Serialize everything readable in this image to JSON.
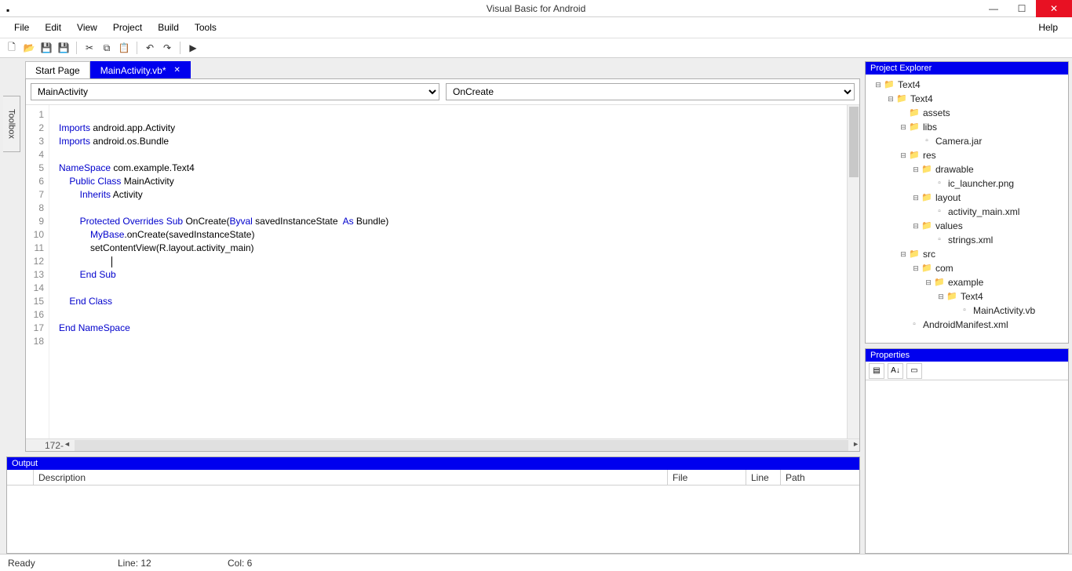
{
  "window": {
    "title": "Visual Basic for Android"
  },
  "menu": {
    "file": "File",
    "edit": "Edit",
    "view": "View",
    "project": "Project",
    "build": "Build",
    "tools": "Tools",
    "help": "Help"
  },
  "tabs": {
    "start": "Start Page",
    "active": "MainActivity.vb*"
  },
  "combos": {
    "left": "MainActivity",
    "right": "OnCreate"
  },
  "code": {
    "lines": [
      "1",
      "2",
      "3",
      "4",
      "5",
      "6",
      "7",
      "8",
      "9",
      "10",
      "11",
      "12",
      "13",
      "14",
      "15",
      "16",
      "17",
      "18"
    ]
  },
  "code_tokens": [
    [],
    [
      {
        "t": "Imports",
        "k": 1
      },
      {
        "t": " android.app.Activity"
      }
    ],
    [
      {
        "t": "Imports",
        "k": 1
      },
      {
        "t": " android.os.Bundle"
      }
    ],
    [],
    [
      {
        "t": "NameSpace",
        "k": 1
      },
      {
        "t": " com.example.Text4"
      }
    ],
    [
      {
        "t": "    "
      },
      {
        "t": "Public",
        "k": 1
      },
      {
        "t": " "
      },
      {
        "t": "Class",
        "k": 1
      },
      {
        "t": " MainActivity"
      }
    ],
    [
      {
        "t": "        "
      },
      {
        "t": "Inherits",
        "k": 1
      },
      {
        "t": " Activity"
      }
    ],
    [],
    [
      {
        "t": "        "
      },
      {
        "t": "Protected",
        "k": 1
      },
      {
        "t": " "
      },
      {
        "t": "Overrides",
        "k": 1
      },
      {
        "t": " "
      },
      {
        "t": "Sub",
        "k": 1
      },
      {
        "t": " OnCreate("
      },
      {
        "t": "Byval",
        "k": 1
      },
      {
        "t": " savedInstanceState  "
      },
      {
        "t": "As",
        "k": 1
      },
      {
        "t": " Bundle)"
      }
    ],
    [
      {
        "t": "            "
      },
      {
        "t": "MyBase",
        "k": 1
      },
      {
        "t": ".onCreate(savedInstanceState)"
      }
    ],
    [
      {
        "t": "            setContentView(R.layout.activity_main)"
      }
    ],
    [
      {
        "t": "                    "
      },
      {
        "cur": 1
      }
    ],
    [
      {
        "t": "        "
      },
      {
        "t": "End",
        "k": 1
      },
      {
        "t": " "
      },
      {
        "t": "Sub",
        "k": 1
      }
    ],
    [],
    [
      {
        "t": "    "
      },
      {
        "t": "End",
        "k": 1
      },
      {
        "t": " "
      },
      {
        "t": "Class",
        "k": 1
      }
    ],
    [],
    [
      {
        "t": "End",
        "k": 1
      },
      {
        "t": " "
      },
      {
        "t": "NameSpace",
        "k": 1
      }
    ],
    []
  ],
  "zoom": "172-",
  "output": {
    "title": "Output",
    "cols": {
      "desc": "Description",
      "file": "File",
      "line": "Line",
      "path": "Path"
    }
  },
  "explorer": {
    "title": "Project Explorer"
  },
  "tree": [
    {
      "d": 0,
      "e": "-",
      "ic": "f",
      "l": "Text4"
    },
    {
      "d": 1,
      "e": "-",
      "ic": "f",
      "l": "Text4"
    },
    {
      "d": 2,
      "e": "",
      "ic": "f",
      "l": "assets"
    },
    {
      "d": 2,
      "e": "-",
      "ic": "f",
      "l": "libs"
    },
    {
      "d": 3,
      "e": "",
      "ic": "i",
      "l": "Camera.jar"
    },
    {
      "d": 2,
      "e": "-",
      "ic": "f",
      "l": "res"
    },
    {
      "d": 3,
      "e": "-",
      "ic": "f",
      "l": "drawable"
    },
    {
      "d": 4,
      "e": "",
      "ic": "i",
      "l": "ic_launcher.png"
    },
    {
      "d": 3,
      "e": "-",
      "ic": "f",
      "l": "layout"
    },
    {
      "d": 4,
      "e": "",
      "ic": "i",
      "l": "activity_main.xml"
    },
    {
      "d": 3,
      "e": "-",
      "ic": "f",
      "l": "values"
    },
    {
      "d": 4,
      "e": "",
      "ic": "i",
      "l": "strings.xml"
    },
    {
      "d": 2,
      "e": "-",
      "ic": "f",
      "l": "src"
    },
    {
      "d": 3,
      "e": "-",
      "ic": "f",
      "l": "com"
    },
    {
      "d": 4,
      "e": "-",
      "ic": "f",
      "l": "example"
    },
    {
      "d": 5,
      "e": "-",
      "ic": "f",
      "l": "Text4"
    },
    {
      "d": 6,
      "e": "",
      "ic": "i",
      "l": "MainActivity.vb"
    },
    {
      "d": 2,
      "e": "",
      "ic": "i",
      "l": "AndroidManifest.xml"
    }
  ],
  "properties": {
    "title": "Properties"
  },
  "toolbox": {
    "label": "Toolbox"
  },
  "status": {
    "ready": "Ready",
    "line": "Line: 12",
    "col": "Col: 6"
  }
}
